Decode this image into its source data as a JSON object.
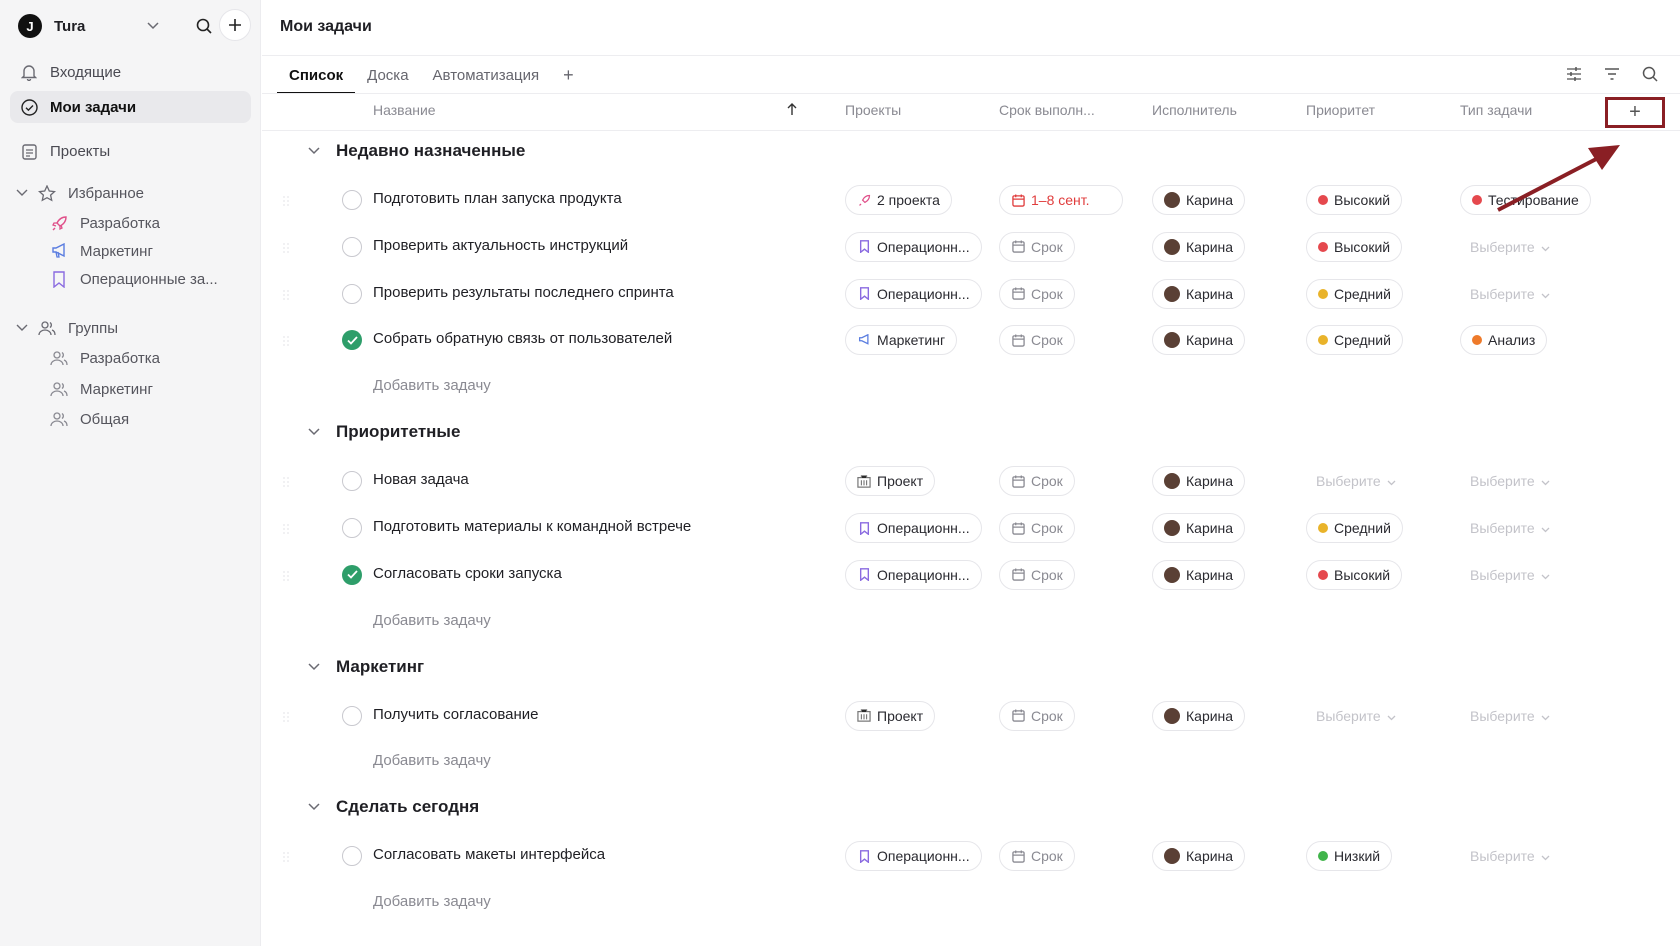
{
  "sidebar": {
    "workspace": "Tura",
    "logo_letter": "J",
    "nav": [
      {
        "label": "Входящие",
        "icon": "bell-icon"
      },
      {
        "label": "Мои задачи",
        "icon": "check-circle-icon"
      },
      {
        "label": "Проекты",
        "icon": "clipboard-icon"
      }
    ],
    "favorites": {
      "label": "Избранное",
      "items": [
        {
          "label": "Разработка",
          "icon": "rocket-icon"
        },
        {
          "label": "Маркетинг",
          "icon": "megaphone-icon"
        },
        {
          "label": "Операционные за...",
          "icon": "bookmark-icon"
        }
      ]
    },
    "groups": {
      "label": "Группы",
      "items": [
        {
          "label": "Разработка"
        },
        {
          "label": "Маркетинг"
        },
        {
          "label": "Общая"
        }
      ]
    }
  },
  "header": {
    "title": "Мои задачи",
    "tabs": [
      "Список",
      "Доска",
      "Автоматизация"
    ],
    "add_tab": "+"
  },
  "columns": {
    "name": "Название",
    "projects": "Проекты",
    "due": "Срок выполн...",
    "assignee": "Исполнитель",
    "priority": "Приоритет",
    "type": "Тип задачи",
    "add": "+"
  },
  "colors": {
    "high": "#e5484d",
    "medium": "#e9b32a",
    "low": "#40b44a",
    "analysis": "#ee7a2a",
    "done": "#2e9e6a",
    "annotation": "#8a1f24"
  },
  "sections": [
    {
      "title": "Недавно назначенные",
      "add_label": "Добавить задачу",
      "tasks": [
        {
          "name": "Подготовить план запуска продукта",
          "done": false,
          "project": "2 проекта",
          "project_icon": "rocket-icon",
          "due": "1–8 сент.",
          "assignee": "Карина",
          "priority": "Высокий",
          "type": "Тестирование"
        },
        {
          "name": "Проверить актуальность инструкций",
          "done": false,
          "project": "Операционн...",
          "project_icon": "bookmark-icon",
          "due": "Срок",
          "assignee": "Карина",
          "priority": "Высокий",
          "type": "Выберите"
        },
        {
          "name": "Проверить результаты последнего спринта",
          "done": false,
          "project": "Операционн...",
          "project_icon": "bookmark-icon",
          "due": "Срок",
          "assignee": "Карина",
          "priority": "Средний",
          "type": "Выберите"
        },
        {
          "name": "Собрать обратную связь от пользователей",
          "done": true,
          "project": "Маркетинг",
          "project_icon": "megaphone-icon",
          "due": "Срок",
          "assignee": "Карина",
          "priority": "Средний",
          "type": "Анализ"
        }
      ]
    },
    {
      "title": "Приоритетные",
      "add_label": "Добавить задачу",
      "tasks": [
        {
          "name": "Новая задача",
          "done": false,
          "project": "Проект",
          "project_icon": "building-icon",
          "due": "Срок",
          "assignee": "Карина",
          "priority": "Выберите",
          "type": "Выберите"
        },
        {
          "name": "Подготовить материалы к командной встрече",
          "done": false,
          "project": "Операционн...",
          "project_icon": "bookmark-icon",
          "due": "Срок",
          "assignee": "Карина",
          "priority": "Средний",
          "type": "Выберите"
        },
        {
          "name": "Согласовать сроки запуска",
          "done": true,
          "project": "Операционн...",
          "project_icon": "bookmark-icon",
          "due": "Срок",
          "assignee": "Карина",
          "priority": "Высокий",
          "type": "Выберите"
        }
      ]
    },
    {
      "title": "Маркетинг",
      "add_label": "Добавить задачу",
      "tasks": [
        {
          "name": "Получить согласование",
          "done": false,
          "project": "Проект",
          "project_icon": "building-icon",
          "due": "Срок",
          "assignee": "Карина",
          "priority": "Выберите",
          "type": "Выберите"
        }
      ]
    },
    {
      "title": "Сделать сегодня",
      "add_label": "Добавить задачу",
      "tasks": [
        {
          "name": "Согласовать макеты интерфейса",
          "done": false,
          "project": "Операционн...",
          "project_icon": "bookmark-icon",
          "due": "Срок",
          "assignee": "Карина",
          "priority": "Низкий",
          "type": "Выберите"
        }
      ]
    }
  ]
}
